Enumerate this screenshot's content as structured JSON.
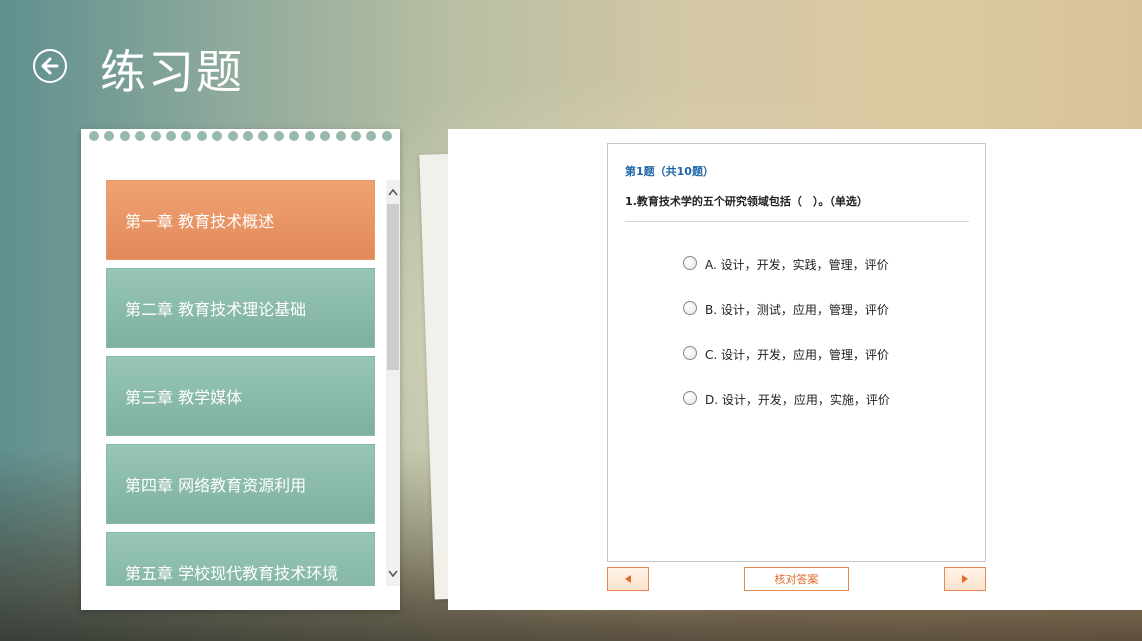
{
  "header": {
    "title": "练习题",
    "back_icon": "arrow-left-circle-icon"
  },
  "chapters": [
    {
      "label": "第一章 教育技术概述",
      "active": true
    },
    {
      "label": "第二章 教育技术理论基础",
      "active": false
    },
    {
      "label": "第三章 教学媒体",
      "active": false
    },
    {
      "label": "第四章 网络教育资源利用",
      "active": false
    },
    {
      "label": "第五章 学校现代教育技术环境",
      "active": false
    }
  ],
  "quiz": {
    "counter": "第1题（共10题）",
    "question": "1.教育技术学的五个研究领域包括（　）。（单选）",
    "options": [
      "A. 设计，开发，实践，管理，评价",
      "B. 设计，测试，应用，管理，评价",
      "C. 设计，开发，应用，管理，评价",
      "D. 设计，开发，应用，实施，评价"
    ],
    "check_label": "核对答案"
  },
  "colors": {
    "active_chapter": "#e8915f",
    "chapter": "#8bbcab",
    "accent_link": "#1e67a6",
    "button_border": "#e8894f"
  },
  "icons": {
    "prev": "triangle-left-icon",
    "next": "triangle-right-icon",
    "scroll_up": "chevron-up-icon",
    "scroll_down": "chevron-down-icon"
  }
}
